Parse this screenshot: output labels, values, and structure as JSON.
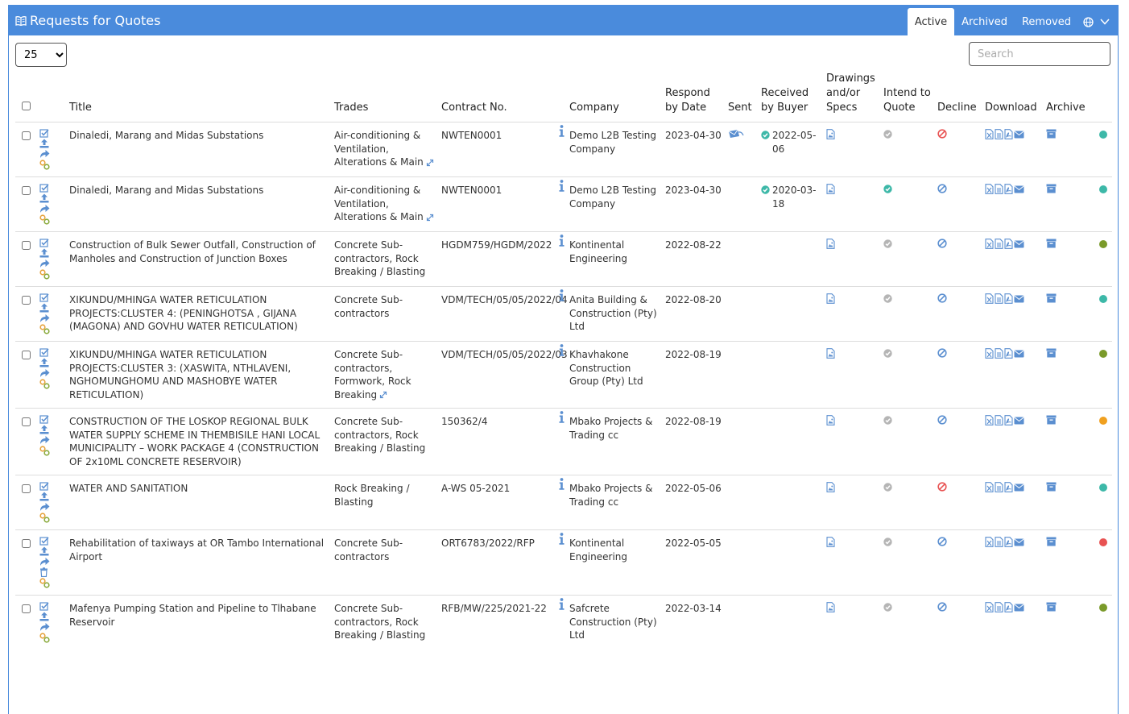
{
  "header": {
    "title": "Requests for Quotes",
    "tabs": [
      {
        "label": "Active",
        "active": true
      },
      {
        "label": "Archived"
      },
      {
        "label": "Removed"
      }
    ]
  },
  "controls": {
    "page_length": "25",
    "search_placeholder": "Search"
  },
  "columns": {
    "title": "Title",
    "trades": "Trades",
    "contract": "Contract No.",
    "company": "Company",
    "respond": "Respond by Date",
    "sent": "Sent",
    "received": "Received by Buyer",
    "drawings": "Drawings and/or Specs",
    "intend": "Intend to Quote",
    "decline": "Decline",
    "download": "Download",
    "archive": "Archive"
  },
  "colors": {
    "header": "#4a8bdc",
    "icon": "#5b8fd0",
    "teal": "#3db8a8",
    "green": "#7a9a2a",
    "orange": "#f0a020",
    "red": "#e85252"
  },
  "rows": [
    {
      "title": "Dinaledi, Marang and Midas Substations",
      "trades": "Air-conditioning & Ventilation, Alterations & Main",
      "trades_more": true,
      "contract": "NWTEN0001",
      "company": "Demo L2B Testing Company",
      "respond": "2023-04-30",
      "sent": true,
      "received": "2022-05-06",
      "intend": "grey",
      "decline": "red",
      "status": "teal",
      "delete_icon": false
    },
    {
      "title": "Dinaledi, Marang and Midas Substations",
      "trades": "Air-conditioning & Ventilation, Alterations & Main",
      "trades_more": true,
      "contract": "NWTEN0001",
      "company": "Demo L2B Testing Company",
      "respond": "2023-04-30",
      "sent": false,
      "received": "2020-03-18",
      "intend": "teal",
      "decline": "blue",
      "status": "teal",
      "delete_icon": false
    },
    {
      "title": "Construction of Bulk Sewer Outfall, Construction of Manholes and Construction of Junction Boxes",
      "trades": "Concrete Sub-contractors, Rock Breaking / Blasting",
      "trades_more": false,
      "contract": "HGDM759/HGDM/2022",
      "company": "Kontinental Engineering",
      "respond": "2022-08-22",
      "sent": false,
      "received": "",
      "intend": "grey",
      "decline": "blue",
      "status": "green",
      "delete_icon": false
    },
    {
      "title": "XIKUNDU/MHINGA WATER RETICULATION PROJECTS:CLUSTER 4: (PENINGHOTSA , GIJANA (MAGONA) AND GOVHU WATER RETICULATION)",
      "trades": "Concrete Sub-contractors",
      "trades_more": false,
      "contract": "VDM/TECH/05/05/2022/04",
      "company": "Anita Building & Construction (Pty) Ltd",
      "respond": "2022-08-20",
      "sent": false,
      "received": "",
      "intend": "grey",
      "decline": "blue",
      "status": "teal",
      "delete_icon": false
    },
    {
      "title": "XIKUNDU/MHINGA WATER RETICULATION PROJECTS:CLUSTER 3: (XASWITA, NTHLAVENI, NGHOMUNGHOMU AND MASHOBYE WATER RETICULATION)",
      "trades": "Concrete Sub-contractors, Formwork, Rock Breaking",
      "trades_more": true,
      "contract": "VDM/TECH/05/05/2022/03",
      "company": "Khavhakone Construction Group (Pty) Ltd",
      "respond": "2022-08-19",
      "sent": false,
      "received": "",
      "intend": "grey",
      "decline": "blue",
      "status": "green",
      "delete_icon": false
    },
    {
      "title": "CONSTRUCTION OF THE LOSKOP REGIONAL BULK WATER SUPPLY SCHEME IN THEMBISILE HANI LOCAL MUNICIPALITY – WORK PACKAGE 4 (CONSTRUCTION OF 2x10ML CONCRETE RESERVOIR)",
      "trades": "Concrete Sub-contractors, Rock Breaking / Blasting",
      "trades_more": false,
      "contract": "150362/4",
      "company": "Mbako Projects & Trading cc",
      "respond": "2022-08-19",
      "sent": false,
      "received": "",
      "intend": "grey",
      "decline": "blue",
      "status": "orange",
      "delete_icon": false
    },
    {
      "title": "WATER AND SANITATION",
      "trades": "Rock Breaking / Blasting",
      "trades_more": false,
      "contract": "A-WS 05-2021",
      "company": "Mbako Projects & Trading cc",
      "respond": "2022-05-06",
      "sent": false,
      "received": "",
      "intend": "grey",
      "decline": "red",
      "status": "teal",
      "delete_icon": false
    },
    {
      "title": "Rehabilitation of taxiways at OR Tambo International Airport",
      "trades": "Concrete Sub-contractors",
      "trades_more": false,
      "contract": "ORT6783/2022/RFP",
      "company": "Kontinental Engineering",
      "respond": "2022-05-05",
      "sent": false,
      "received": "",
      "intend": "grey",
      "decline": "blue",
      "status": "red",
      "delete_icon": true
    },
    {
      "title": "Mafenya Pumping Station and Pipeline to Tlhabane Reservoir",
      "trades": "Concrete Sub-contractors, Rock Breaking / Blasting",
      "trades_more": false,
      "contract": "RFB/MW/225/2021-22",
      "company": "Safcrete Construction (Pty) Ltd",
      "respond": "2022-03-14",
      "sent": false,
      "received": "",
      "intend": "grey",
      "decline": "blue",
      "status": "green",
      "delete_icon": false
    }
  ]
}
